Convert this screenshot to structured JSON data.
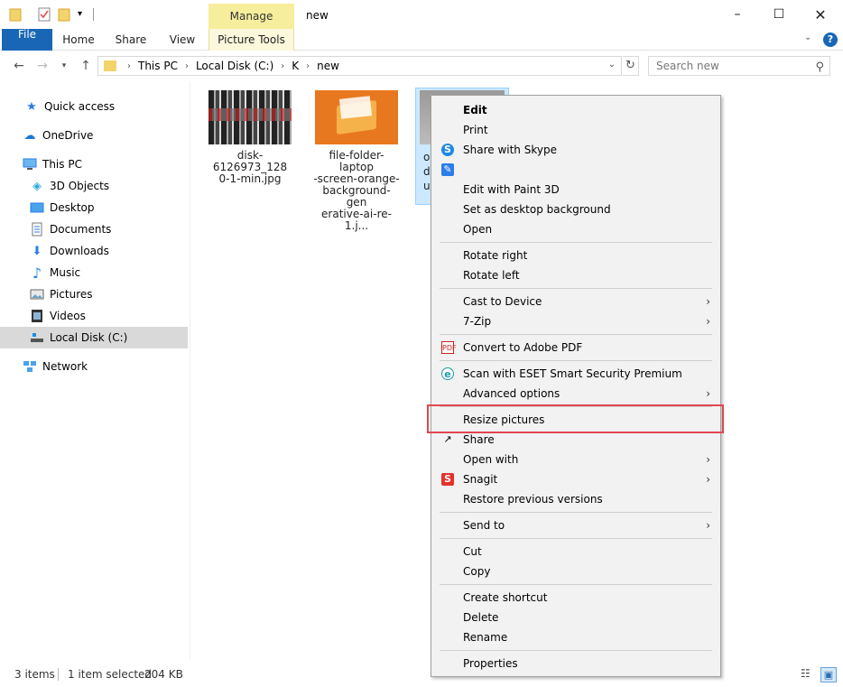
{
  "window": {
    "title": "new",
    "context_tab": "Manage",
    "controls": {
      "minimize": "–",
      "maximize": "☐",
      "close": "✕"
    }
  },
  "ribbon": {
    "tabs": [
      "File",
      "Home",
      "Share",
      "View",
      "Picture Tools"
    ],
    "expand": "⌄",
    "help": "?"
  },
  "address": {
    "breadcrumb": [
      "This PC",
      "Local Disk (C:)",
      "K",
      "new"
    ],
    "search_placeholder": "Search new",
    "separator": "›"
  },
  "sidebar": {
    "items": [
      {
        "label": "Quick access",
        "icon": "star-icon",
        "glyph": "★",
        "color": "#2b7de9"
      },
      {
        "label": "OneDrive",
        "icon": "cloud-icon",
        "glyph": "☁",
        "color": "#1e78d6"
      },
      {
        "label": "This PC",
        "icon": "computer-icon",
        "glyph": "🖥",
        "color": "#2b7de9"
      },
      {
        "label": "3D Objects",
        "icon": "cube-icon",
        "glyph": "◈",
        "color": "#2aa7d8"
      },
      {
        "label": "Desktop",
        "icon": "desktop-icon",
        "glyph": "▭",
        "color": "#2b7de9"
      },
      {
        "label": "Documents",
        "icon": "document-icon",
        "glyph": "▤",
        "color": "#555555"
      },
      {
        "label": "Downloads",
        "icon": "download-icon",
        "glyph": "⬇",
        "color": "#2b7de9"
      },
      {
        "label": "Music",
        "icon": "music-icon",
        "glyph": "♪",
        "color": "#2b7de9"
      },
      {
        "label": "Pictures",
        "icon": "pictures-icon",
        "glyph": "▨",
        "color": "#555555"
      },
      {
        "label": "Videos",
        "icon": "video-icon",
        "glyph": "▦",
        "color": "#333333"
      },
      {
        "label": "Local Disk (C:)",
        "icon": "drive-icon",
        "glyph": "▬",
        "color": "#333333"
      },
      {
        "label": "Network",
        "icon": "network-icon",
        "glyph": "⊞",
        "color": "#2b7de9"
      }
    ]
  },
  "files": [
    {
      "name_lines": [
        "disk-6126973_128",
        "0-1-min.jpg"
      ]
    },
    {
      "name_lines": [
        "file-folder-laptop",
        "-screen-orange-",
        "background-gen",
        "erative-ai-re-1.j..."
      ]
    },
    {
      "name_lines": [
        "o",
        "d",
        "u"
      ]
    }
  ],
  "context_menu": {
    "items": [
      {
        "label": "Edit",
        "bold": true
      },
      {
        "label": "Print"
      },
      {
        "label": "Share with Skype",
        "icon": "skype-icon"
      },
      {
        "label": "",
        "icon": "paint3d-icon"
      },
      {
        "label": "Edit with Paint 3D"
      },
      {
        "label": "Set as desktop background"
      },
      {
        "label": "Open"
      },
      {
        "label": "Rotate right"
      },
      {
        "label": "Rotate left"
      },
      {
        "label": "Cast to Device",
        "submenu": true
      },
      {
        "label": "7-Zip",
        "submenu": true
      },
      {
        "label": "Convert to Adobe PDF",
        "icon": "pdf-icon"
      },
      {
        "label": "Scan with ESET Smart Security Premium",
        "icon": "eset-icon"
      },
      {
        "label": "Advanced options",
        "submenu": true
      },
      {
        "label": "Resize pictures"
      },
      {
        "label": "Share",
        "icon": "share-icon"
      },
      {
        "label": "Open with",
        "submenu": true
      },
      {
        "label": "Snagit",
        "icon": "snagit-icon",
        "submenu": true
      },
      {
        "label": "Restore previous versions"
      },
      {
        "label": "Send to",
        "submenu": true
      },
      {
        "label": "Cut"
      },
      {
        "label": "Copy"
      },
      {
        "label": "Create shortcut"
      },
      {
        "label": "Delete"
      },
      {
        "label": "Rename"
      },
      {
        "label": "Properties"
      }
    ],
    "submenu_arrow": "›"
  },
  "status": {
    "items": "3 items",
    "selected": "1 item selected",
    "size": "204 KB"
  },
  "colors": {
    "accent": "#1a66b6",
    "highlight": "#e0474e",
    "manage_tab": "#f6ee9c",
    "selection": "#cce8ff"
  }
}
